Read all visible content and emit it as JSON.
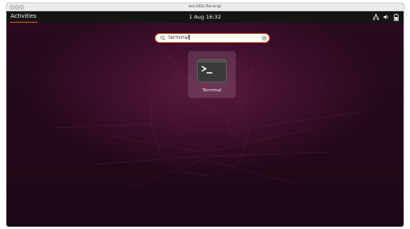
{
  "window": {
    "title": "ksis-2022 [Running]"
  },
  "topbar": {
    "activities_label": "Activities",
    "clock": "1 Aug  16:32",
    "tray_icons": [
      "network-icon",
      "volume-icon",
      "battery-icon"
    ]
  },
  "search": {
    "query": "terminal",
    "icon": "search-icon",
    "clear_icon": "clear-icon"
  },
  "results": [
    {
      "label": "Terminal",
      "icon": "terminal-icon",
      "selected": true
    }
  ],
  "colors": {
    "accent": "#e95420",
    "topbar": "#151515",
    "background": "#2c0b22"
  }
}
